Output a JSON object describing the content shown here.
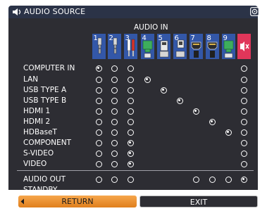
{
  "title": "AUDIO SOURCE",
  "audio_in_header": "AUDIO IN",
  "audio_in_inputs": [
    {
      "label": "1",
      "type": "minijack"
    },
    {
      "label": "2",
      "type": "minijack"
    },
    {
      "label": "3",
      "type": "rca-lr"
    },
    {
      "label": "4",
      "type": "lan"
    },
    {
      "label": "5",
      "type": "usb-a"
    },
    {
      "label": "6",
      "type": "usb-b"
    },
    {
      "label": "7",
      "type": "hdmi"
    },
    {
      "label": "8",
      "type": "hdmi"
    },
    {
      "label": "9",
      "type": "hdbaset"
    },
    {
      "label": "",
      "type": "mute"
    }
  ],
  "sources": [
    {
      "label": "COMPUTER IN",
      "selected": 1
    },
    {
      "label": "LAN",
      "selected": 4
    },
    {
      "label": "USB TYPE A",
      "selected": 5
    },
    {
      "label": "USB TYPE B",
      "selected": 6
    },
    {
      "label": "HDMI 1",
      "selected": 7
    },
    {
      "label": "HDMI 2",
      "selected": 8
    },
    {
      "label": "HDBaseT",
      "selected": 9
    },
    {
      "label": "COMPONENT",
      "selected": 3
    },
    {
      "label": "S-VIDEO",
      "selected": 3
    },
    {
      "label": "VIDEO",
      "selected": 3
    }
  ],
  "audio_out": {
    "label": "AUDIO OUT",
    "selected": 10
  },
  "standby": {
    "label": "STANDBY"
  },
  "buttons": {
    "return": "RETURN",
    "exit": "EXIT"
  },
  "colors": {
    "accent": "#e98a26",
    "tile_blue": "#3357a8",
    "mute_tile": "#e0365a",
    "panel": "#2d2d33"
  },
  "icons": {
    "title": "speaker-icon",
    "help": "help-icon",
    "mute": "mute-icon"
  }
}
